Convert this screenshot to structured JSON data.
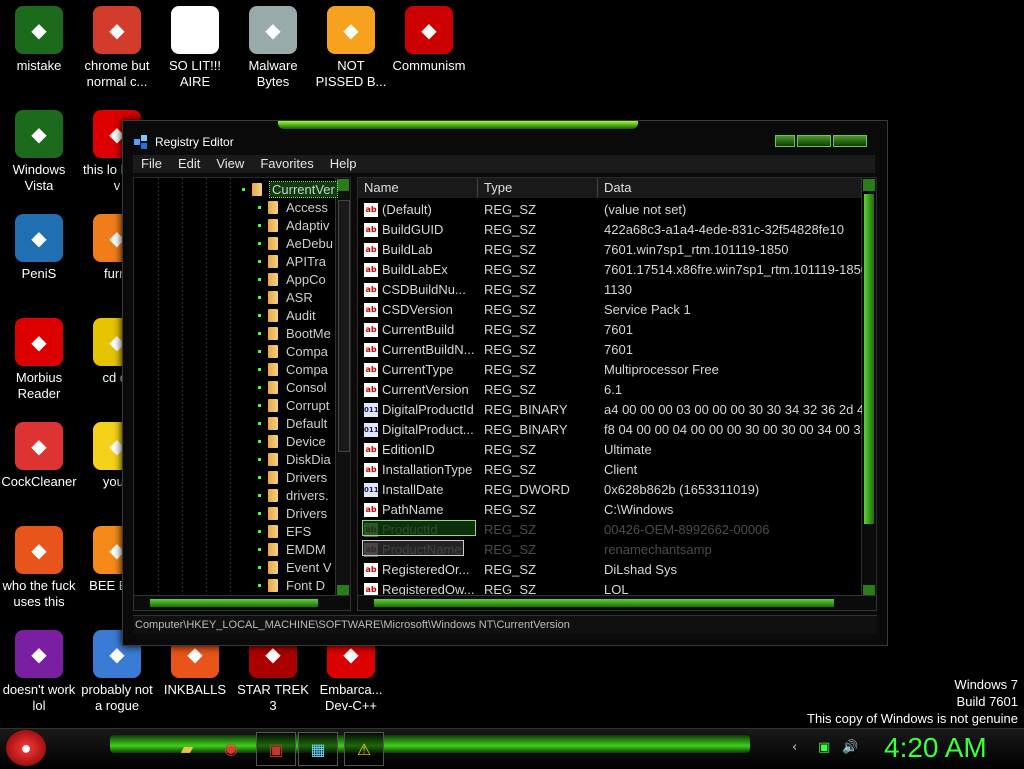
{
  "desktop_icons": [
    {
      "label": "mistake",
      "icon": "green-recycle-orb-icon",
      "color": "#1c6b1c"
    },
    {
      "label": "chrome but normal c...",
      "icon": "chrome-icon",
      "color": "#d33b2c"
    },
    {
      "label": "SO LIT!!! AIRE",
      "icon": "playing-cards-icon",
      "color": "#ffffff"
    },
    {
      "label": "Malware Bytes",
      "icon": "shield-check-icon",
      "color": "#9aa"
    },
    {
      "label": "NOT PISSED B...",
      "icon": "angry-pig-icon",
      "color": "#f6a21e"
    },
    {
      "label": "Communism",
      "icon": "red-emblem-icon",
      "color": "#c00"
    },
    {
      "label": "Windows Vista",
      "icon": "green-recycle-orb-icon",
      "color": "#1c6b1c"
    },
    {
      "label": "this lo like a v",
      "icon": "opera-icon",
      "color": "#d00"
    },
    {
      "label": "PeniS",
      "icon": "photoshop-icon",
      "color": "#1f6fb2"
    },
    {
      "label": "furry",
      "icon": "firefox-icon",
      "color": "#f07d1a"
    },
    {
      "label": "Morbius Reader",
      "icon": "acrobat-icon",
      "color": "#d00"
    },
    {
      "label": "cd dr",
      "icon": "cd-drive-icon",
      "color": "#e6c400"
    },
    {
      "label": "CockCleaner",
      "icon": "ccleaner-icon",
      "color": "#d33"
    },
    {
      "label": "you t",
      "icon": "star-icon",
      "color": "#f5d21a"
    },
    {
      "label": "who the fuck uses this",
      "icon": "lightning-icon",
      "color": "#e8541a"
    },
    {
      "label": "BEE BEE",
      "icon": "vlc-cone-icon",
      "color": "#f58a1a"
    },
    {
      "label": "doesn't work lol",
      "icon": "yahoo-messenger-icon",
      "color": "#7b1fa2"
    },
    {
      "label": "probably not a rogue",
      "icon": "monitor-gears-icon",
      "color": "#3a7bd5"
    },
    {
      "label": "INKBALLS",
      "icon": "inkball-icon",
      "color": "#e8541a"
    },
    {
      "label": "STAR TREK 3",
      "icon": "star-trek-icon",
      "color": "#a00"
    },
    {
      "label": "Embarca... Dev-C++",
      "icon": "devcpp-icon",
      "color": "#d00"
    }
  ],
  "window": {
    "title": "Registry Editor",
    "menu": [
      "File",
      "Edit",
      "View",
      "Favorites",
      "Help"
    ],
    "tree": [
      "CurrentVer",
      "Access",
      "Adaptiv",
      "AeDebu",
      "APITra",
      "AppCo",
      "ASR",
      "Audit",
      "BootMe",
      "Compa",
      "Compa",
      "Consol",
      "Corrupt",
      "Default",
      "Device",
      "DiskDia",
      "Drivers",
      "drivers.",
      "Drivers",
      "EFS",
      "EMDM",
      "Event V",
      "Font D"
    ],
    "columns": {
      "name": "Name",
      "type": "Type",
      "data": "Data"
    },
    "values": [
      {
        "name": "(Default)",
        "type": "REG_SZ",
        "data": "(value not set)",
        "kind": "sz"
      },
      {
        "name": "BuildGUID",
        "type": "REG_SZ",
        "data": "422a68c3-a1a4-4ede-831c-32f54828fe10",
        "kind": "sz"
      },
      {
        "name": "BuildLab",
        "type": "REG_SZ",
        "data": "7601.win7sp1_rtm.101119-1850",
        "kind": "sz"
      },
      {
        "name": "BuildLabEx",
        "type": "REG_SZ",
        "data": "7601.17514.x86fre.win7sp1_rtm.101119-1850",
        "kind": "sz"
      },
      {
        "name": "CSDBuildNu...",
        "type": "REG_SZ",
        "data": "1130",
        "kind": "sz"
      },
      {
        "name": "CSDVersion",
        "type": "REG_SZ",
        "data": "Service Pack 1",
        "kind": "sz"
      },
      {
        "name": "CurrentBuild",
        "type": "REG_SZ",
        "data": "7601",
        "kind": "sz"
      },
      {
        "name": "CurrentBuildN...",
        "type": "REG_SZ",
        "data": "7601",
        "kind": "sz"
      },
      {
        "name": "CurrentType",
        "type": "REG_SZ",
        "data": "Multiprocessor Free",
        "kind": "sz"
      },
      {
        "name": "CurrentVersion",
        "type": "REG_SZ",
        "data": "6.1",
        "kind": "sz"
      },
      {
        "name": "DigitalProductId",
        "type": "REG_BINARY",
        "data": "a4 00 00 00 03 00 00 00 30 30 34 32 36 2d 4",
        "kind": "bin"
      },
      {
        "name": "DigitalProduct...",
        "type": "REG_BINARY",
        "data": "f8 04 00 00 04 00 00 00 30 00 30 00 34 00 3",
        "kind": "bin"
      },
      {
        "name": "EditionID",
        "type": "REG_SZ",
        "data": "Ultimate",
        "kind": "sz"
      },
      {
        "name": "InstallationType",
        "type": "REG_SZ",
        "data": "Client",
        "kind": "sz"
      },
      {
        "name": "InstallDate",
        "type": "REG_DWORD",
        "data": "0x628b862b (1653311019)",
        "kind": "bin"
      },
      {
        "name": "PathName",
        "type": "REG_SZ",
        "data": "C:\\Windows",
        "kind": "sz"
      },
      {
        "name": "ProductId",
        "type": "REG_SZ",
        "data": "00426-OEM-8992662-00006",
        "kind": "sz"
      },
      {
        "name": "ProductName",
        "type": "REG_SZ",
        "data": "renamechantsamp",
        "kind": "sz"
      },
      {
        "name": "RegisteredOr...",
        "type": "REG_SZ",
        "data": "DiLshad Sys",
        "kind": "sz"
      },
      {
        "name": "RegisteredOw...",
        "type": "REG_SZ",
        "data": "LOL",
        "kind": "sz"
      }
    ],
    "status_path": "Computer\\HKEY_LOCAL_MACHINE\\SOFTWARE\\Microsoft\\Windows NT\\CurrentVersion"
  },
  "watermark": {
    "line1": "Windows 7",
    "line2": "Build 7601",
    "line3": "This copy of Windows is not genuine"
  },
  "taskbar": {
    "clock": "4:20 AM",
    "accent": "#3cff3c"
  }
}
